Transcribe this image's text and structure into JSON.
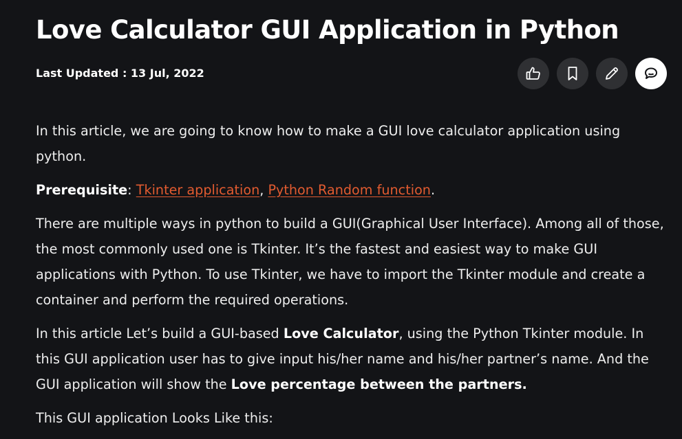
{
  "article": {
    "title": "Love Calculator GUI Application in Python",
    "last_updated": "Last Updated : 13 Jul, 2022",
    "actions": [
      {
        "name": "like",
        "icon": "thumbs-up-icon"
      },
      {
        "name": "bookmark",
        "icon": "bookmark-icon"
      },
      {
        "name": "edit",
        "icon": "pencil-icon"
      },
      {
        "name": "comments",
        "icon": "chat-icon"
      }
    ],
    "p1": "In this article, we are going to know how to make a GUI love calculator application using python.",
    "prereq": {
      "label": "Prerequisite",
      "colon": ": ",
      "link1": "Tkinter application",
      "sep": ", ",
      "link2": "Python Random function",
      "end": "."
    },
    "p3": "There are multiple ways in python to build a GUI(Graphical User Interface).  Among all of those, the most commonly used one is Tkinter. It’s the fastest and easiest way to make GUI applications with Python.  To use Tkinter, we have to import the Tkinter module and create a container and perform the required operations.",
    "p4": {
      "a": "In this article Let’s build a GUI-based ",
      "b": "Love Calculator",
      "c": ", using the Python Tkinter module. In this GUI application user has to give input his/her name and his/her partner’s name. And the GUI application will show the ",
      "d": "Love percentage between the partners."
    },
    "p5": "This GUI application Looks Like this:"
  },
  "colors": {
    "background": "#131417",
    "link": "#e25b30",
    "button": "#2f3033"
  }
}
